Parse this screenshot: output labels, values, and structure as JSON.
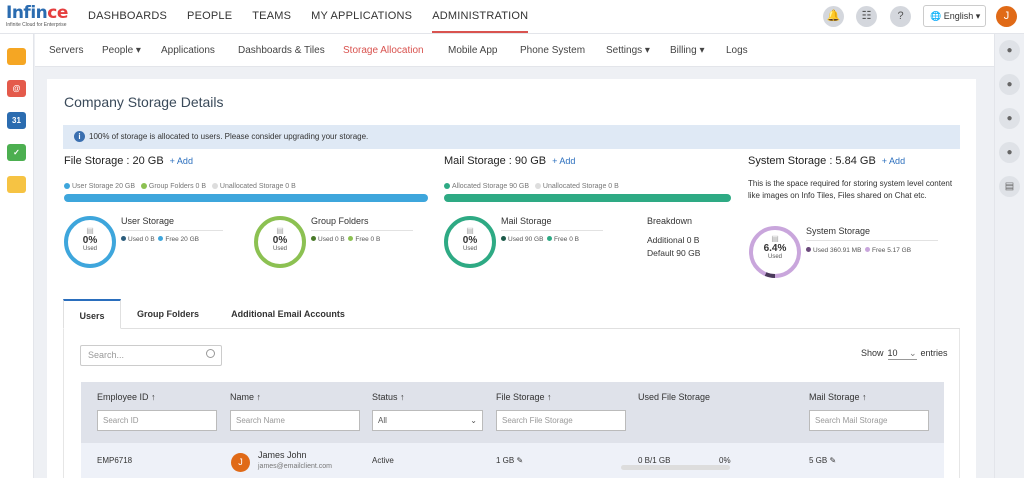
{
  "app": {
    "logo_main": "Infin",
    "logo_accent": "ce",
    "logo_sub": "Infinite Cloud for Enterprise"
  },
  "topnav": [
    "DASHBOARDS",
    "PEOPLE",
    "TEAMS",
    "MY APPLICATIONS",
    "ADMINISTRATION"
  ],
  "topnav_active": "ADMINISTRATION",
  "header": {
    "language": "English ▾",
    "user_initial": "J"
  },
  "subnav": [
    "Servers",
    "People ▾",
    "Applications",
    "Dashboards & Tiles",
    "Storage Allocation",
    "Mobile App",
    "Phone System",
    "Settings ▾",
    "Billing ▾",
    "Logs"
  ],
  "subnav_active": "Storage Allocation",
  "page": {
    "title": "Company Storage Details",
    "info": "100% of storage is allocated to users. Please consider upgrading your storage."
  },
  "file_storage": {
    "title": "File Storage : 20 GB",
    "add": "+ Add",
    "legend": [
      "User Storage 20 GB",
      "Group Folders 0 B",
      "Unallocated Storage 0 B"
    ],
    "user": {
      "label": "User Storage",
      "percent": "0%",
      "used_text": "Used",
      "used": "Used 0 B",
      "free": "Free 20 GB"
    },
    "group": {
      "label": "Group Folders",
      "percent": "0%",
      "used_text": "Used",
      "used": "Used 0 B",
      "free": "Free 0 B"
    }
  },
  "mail_storage": {
    "title": "Mail Storage : 90 GB",
    "add": "+ Add",
    "legend": [
      "Allocated Storage 90 GB",
      "Unallocated Storage 0 B"
    ],
    "mail": {
      "label": "Mail Storage",
      "percent": "0%",
      "used_text": "Used",
      "used": "Used 90 GB",
      "free": "Free 0 B"
    },
    "breakdown": {
      "title": "Breakdown",
      "additional": "Additional 0 B",
      "default": "Default 90 GB"
    }
  },
  "system_storage": {
    "title": "System Storage : 5.84 GB",
    "add": "+ Add",
    "desc": "This is the space required for storing system level content like images on Info Tiles, Files shared on Chat etc.",
    "ring": {
      "label": "System Storage",
      "percent": "6.4%",
      "percent_value": 6.4,
      "used_text": "Used",
      "used": "Used 360.91 MB",
      "free": "Free 5.17 GB"
    }
  },
  "tabs": [
    "Users",
    "Group Folders",
    "Additional Email Accounts"
  ],
  "table": {
    "search_placeholder": "Search...",
    "show": "Show",
    "show_value": "10",
    "entries": "entries",
    "columns": [
      "Employee ID ↑",
      "Name ↑",
      "Status ↑",
      "File Storage ↑",
      "Used File Storage",
      "Mail Storage ↑"
    ],
    "filters": {
      "id": "Search ID",
      "name": "Search Name",
      "status": "All",
      "file": "Search File Storage",
      "mail": "Search Mail Storage"
    },
    "rows": [
      {
        "id": "EMP6718",
        "initial": "J",
        "name": "James John",
        "email": "james@emailclient.com",
        "status": "Active",
        "file": "1 GB",
        "used": "0 B/1 GB",
        "used_pct": "0%",
        "used_fraction": 0,
        "mail": "5 GB"
      }
    ]
  },
  "colors": {
    "blue": "#3ea6dc",
    "green": "#2eaa84",
    "lime": "#8cc152",
    "purple": "#c9a6dc",
    "accent": "#d9534f"
  }
}
